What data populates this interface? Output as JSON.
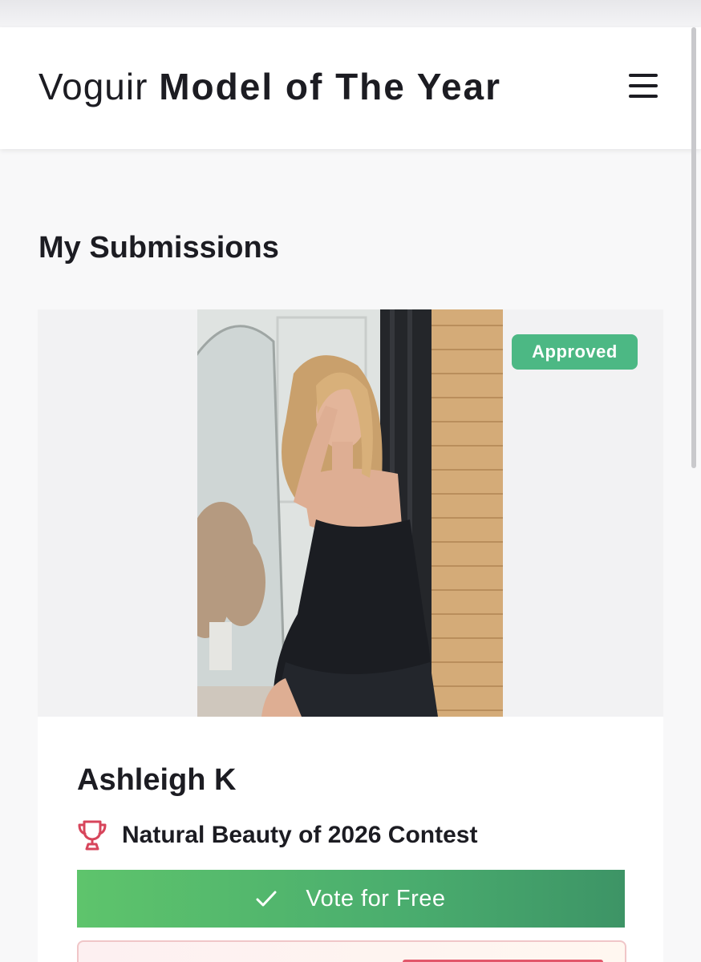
{
  "header": {
    "brand_light": "Voguir",
    "brand_bold": "Model of The Year",
    "menu_icon": "hamburger-menu-icon"
  },
  "main": {
    "section_title": "My Submissions",
    "submission": {
      "status_badge": "Approved",
      "status_color": "#4cb884",
      "model_name": "Ashleigh K",
      "contest_icon": "trophy-icon",
      "contest_name": "Natural Beauty of 2026 Contest",
      "vote_button": {
        "icon": "checkmark-icon",
        "label": "Vote for Free",
        "color_start": "#5ec46c",
        "color_end": "#3d9466"
      }
    }
  }
}
